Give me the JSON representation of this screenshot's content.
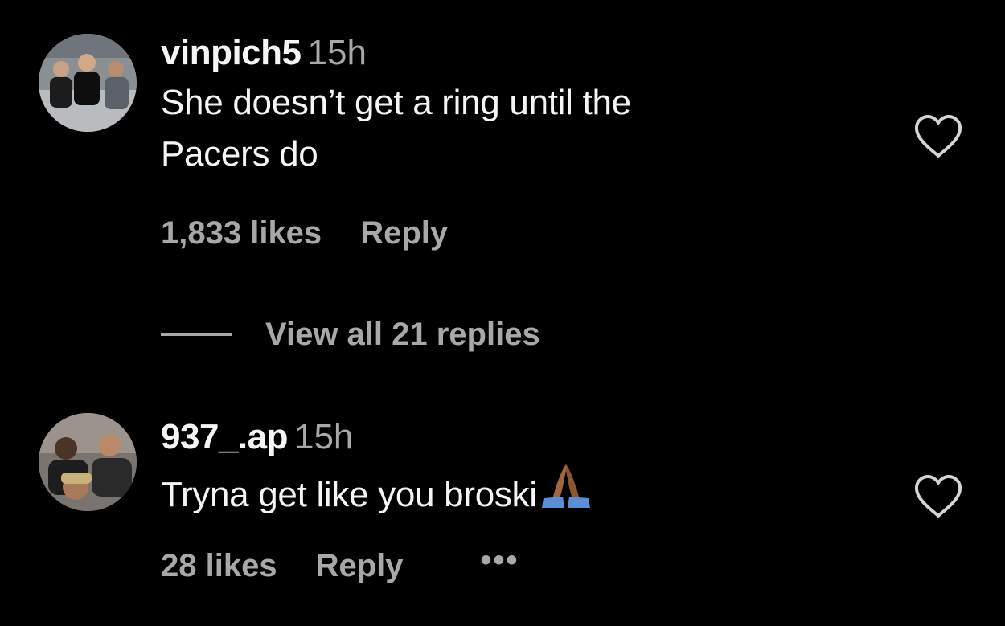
{
  "comments": [
    {
      "username": "vinpich5",
      "time": "15h",
      "text_line1": "She doesn’t get a ring until the",
      "text_line2": "Pacers do",
      "likes": "1,833 likes",
      "reply_label": "Reply",
      "avatar_icon": "group-photo-avatar",
      "like_icon": "heart-outline-icon"
    },
    {
      "username": "937_.ap",
      "time": "15h",
      "text": "Tryna get like you broski",
      "emoji": "folded-hands-emoji",
      "likes": "28 likes",
      "reply_label": "Reply",
      "more_label": "•••",
      "avatar_icon": "selfie-photo-avatar",
      "like_icon": "heart-outline-icon"
    }
  ],
  "view_replies_label": "View all 21 replies",
  "colors": {
    "background": "#000000",
    "primary_text": "#f5f5f5",
    "secondary_text": "#a8a8a8"
  }
}
